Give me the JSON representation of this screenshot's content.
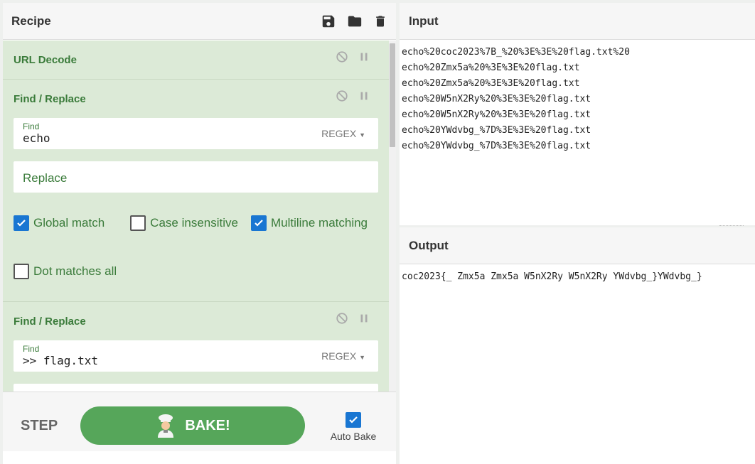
{
  "recipe": {
    "title": "Recipe",
    "icons": [
      "save-icon",
      "folder-icon",
      "trash-icon"
    ]
  },
  "operations": [
    {
      "title": "URL Decode"
    },
    {
      "title": "Find / Replace",
      "find_label": "Find",
      "find_value": "echo",
      "find_mode": "REGEX",
      "replace_placeholder": "Replace",
      "options": [
        {
          "label": "Global match",
          "checked": true
        },
        {
          "label": "Case insensitive",
          "checked": false
        },
        {
          "label": "Multiline matching",
          "checked": true
        },
        {
          "label": "Dot matches all",
          "checked": false
        }
      ]
    },
    {
      "title": "Find / Replace",
      "find_label": "Find",
      "find_value": ">> flag.txt",
      "find_mode": "REGEX"
    }
  ],
  "bake": {
    "step_label": "STEP",
    "bake_label": "BAKE!",
    "autobake_label": "Auto Bake",
    "autobake_checked": true
  },
  "input": {
    "title": "Input",
    "lines": [
      "echo%20coc2023%7B_%20%3E%3E%20flag.txt%20",
      "echo%20Zmx5a%20%3E%3E%20flag.txt",
      "echo%20Zmx5a%20%3E%3E%20flag.txt",
      "echo%20W5nX2Ry%20%3E%3E%20flag.txt",
      "echo%20W5nX2Ry%20%3E%3E%20flag.txt",
      "echo%20YWdvbg_%7D%3E%3E%20flag.txt",
      "echo%20YWdvbg_%7D%3E%3E%20flag.txt"
    ]
  },
  "output": {
    "title": "Output",
    "text": "coc2023{_ Zmx5a Zmx5a W5nX2Ry W5nX2Ry YWdvbg_}YWdvbg_}"
  },
  "colors": {
    "accent_green": "#3a7b3a",
    "op_background": "#dcead7",
    "bake_button": "#56a65a",
    "checkbox_blue": "#1976d2"
  }
}
